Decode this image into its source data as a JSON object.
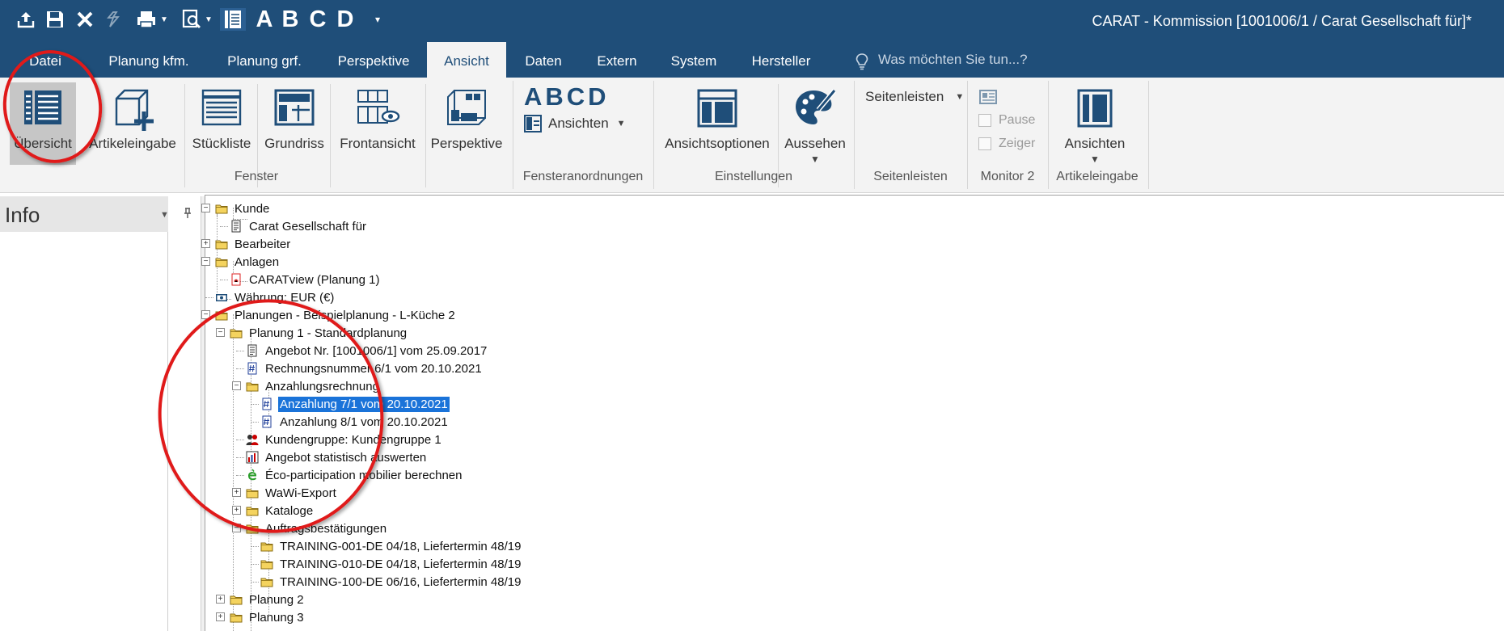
{
  "window": {
    "title": "CARAT - Kommission [1001006/1 / Carat Gesellschaft für]*"
  },
  "quick_access": {
    "icons": [
      "export-icon",
      "save-icon",
      "close-icon",
      "undo-icon",
      "print-icon",
      "print-preview-icon",
      "overview-icon"
    ],
    "letters": [
      "A",
      "B",
      "C",
      "D"
    ]
  },
  "tabs": [
    {
      "label": "Datei"
    },
    {
      "label": "Planung kfm."
    },
    {
      "label": "Planung grf."
    },
    {
      "label": "Perspektive"
    },
    {
      "label": "Ansicht"
    },
    {
      "label": "Daten"
    },
    {
      "label": "Extern"
    },
    {
      "label": "System"
    },
    {
      "label": "Hersteller"
    }
  ],
  "active_tab": "Ansicht",
  "tell_me": {
    "placeholder": "Was möchten Sie tun...?"
  },
  "ribbon": {
    "fenster": {
      "label": "Fenster",
      "buttons": [
        "Übersicht",
        "Artikeleingabe",
        "Stückliste",
        "Grundriss",
        "Frontansicht",
        "Perspektive"
      ]
    },
    "fensteranordnungen": {
      "label": "Fensteranordnungen",
      "letters": "ABCD",
      "ansichten_dropdown": "Ansichten"
    },
    "einstellungen": {
      "label": "Einstellungen",
      "buttons": [
        "Ansichtsoptionen",
        "Aussehen"
      ]
    },
    "seitenleisten": {
      "label": "Seitenleisten",
      "dropdown": "Seitenleisten"
    },
    "monitor2": {
      "label": "Monitor 2",
      "checkboxes": [
        {
          "label": "Pause",
          "checked": false
        },
        {
          "label": "Zeiger",
          "checked": false
        }
      ]
    },
    "artikeleingabe": {
      "label": "Artikeleingabe",
      "button": "Ansichten"
    }
  },
  "info_panel": {
    "title": "Info"
  },
  "tree": [
    {
      "text": "Kunde",
      "icon": "folder-icon",
      "expander": "minus"
    },
    {
      "text": "Carat Gesellschaft für",
      "icon": "document-icon"
    },
    {
      "text": "Bearbeiter",
      "icon": "folder-icon",
      "expander": "plus"
    },
    {
      "text": "Anlagen",
      "icon": "folder-icon",
      "expander": "minus"
    },
    {
      "text": "CARATview (Planung 1)",
      "icon": "pdf-icon"
    },
    {
      "text": "Währung: EUR (€)",
      "icon": "currency-icon"
    },
    {
      "text": "Planungen - Beispielplanung - L-Küche 2",
      "icon": "folder-icon",
      "expander": "minus"
    },
    {
      "text": "Planung  1 - Standardplanung",
      "icon": "folder-icon",
      "expander": "minus"
    },
    {
      "text": "Angebot Nr. [1001006/1] vom 25.09.2017",
      "icon": "document-icon"
    },
    {
      "text": "Rechnungsnummer 6/1 vom 20.10.2021",
      "icon": "invoice-icon"
    },
    {
      "text": "Anzahlungsrechnung",
      "icon": "folder-icon",
      "expander": "minus"
    },
    {
      "text": "Anzahlung 7/1 vom 20.10.2021",
      "icon": "invoice-icon",
      "selected": true
    },
    {
      "text": "Anzahlung 8/1 vom 20.10.2021",
      "icon": "invoice-icon"
    },
    {
      "text": "Kundengruppe: Kundengruppe 1",
      "icon": "customer-group-icon"
    },
    {
      "text": "Angebot statistisch auswerten",
      "icon": "statistics-icon"
    },
    {
      "text": "Éco-participation mobilier berechnen",
      "icon": "eco-icon"
    },
    {
      "text": "WaWi-Export",
      "icon": "folder-icon",
      "expander": "plus"
    },
    {
      "text": "Kataloge",
      "icon": "folder-icon",
      "expander": "plus"
    },
    {
      "text": "Auftragsbestätigungen",
      "icon": "folder-icon",
      "expander": "minus"
    },
    {
      "text": "TRAINING-001-DE 04/18, Liefertermin 48/19",
      "icon": "folder-icon"
    },
    {
      "text": "TRAINING-010-DE 04/18, Liefertermin 48/19",
      "icon": "folder-icon"
    },
    {
      "text": "TRAINING-100-DE 06/16, Liefertermin 48/19",
      "icon": "folder-icon"
    },
    {
      "text": "Planung  2",
      "icon": "folder-icon",
      "expander": "plus"
    },
    {
      "text": "Planung  3",
      "icon": "folder-icon",
      "expander": "plus"
    }
  ],
  "colors": {
    "titlebar": "#1f4e79",
    "ribbon": "#f3f3f3",
    "selection": "#1a73d9",
    "annotation_circle": "#e01a1a"
  }
}
